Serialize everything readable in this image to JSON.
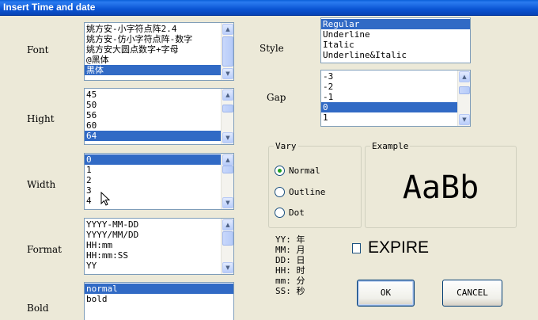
{
  "window": {
    "title": "Insert Time and date"
  },
  "labels": {
    "font": "Font",
    "hight": "Hight",
    "width": "Width",
    "format": "Format",
    "bold": "Bold",
    "style": "Style",
    "gap": "Gap"
  },
  "font_list": {
    "items": [
      "姚方安-小字符点阵2.4",
      "姚方安-仿小字符点阵-数字",
      "姚方安大圆点数字+字母",
      "@黑体",
      "黑体"
    ],
    "selected": "黑体"
  },
  "hight_list": {
    "items": [
      "45",
      "50",
      "56",
      "60",
      "64"
    ],
    "selected": "64"
  },
  "width_list": {
    "items": [
      "0",
      "1",
      "2",
      "3",
      "4"
    ],
    "selected": "0"
  },
  "format_list": {
    "items": [
      "YYYY-MM-DD",
      "YYYY/MM/DD",
      "HH:mm",
      "HH:mm:SS",
      "YY"
    ]
  },
  "bold_list": {
    "items": [
      "normal",
      "bold"
    ],
    "selected": "normal"
  },
  "style_list": {
    "items": [
      "Regular",
      "Underline",
      "Italic",
      "Underline&Italic"
    ],
    "selected": "Regular"
  },
  "gap_list": {
    "items": [
      "-3",
      "-2",
      "-1",
      "0",
      "1"
    ],
    "selected": "0"
  },
  "vary": {
    "title": "Vary",
    "options": [
      "Normal",
      "Outline",
      "Dot"
    ],
    "selected": "Normal"
  },
  "example": {
    "title": "Example",
    "sample": "AaBb"
  },
  "date_codes": [
    "YY: 年",
    "MM: 月",
    "DD: 日",
    "HH: 时",
    "mm: 分",
    "SS: 秒"
  ],
  "expire": {
    "label": "EXPIRE",
    "checked": false
  },
  "buttons": {
    "ok": "OK",
    "cancel": "CANCEL"
  },
  "colors": {
    "titlebar": "#0a5fd8",
    "selection": "#316ac5",
    "dialog_bg": "#ece9d8",
    "radio_dot": "#21a121"
  }
}
